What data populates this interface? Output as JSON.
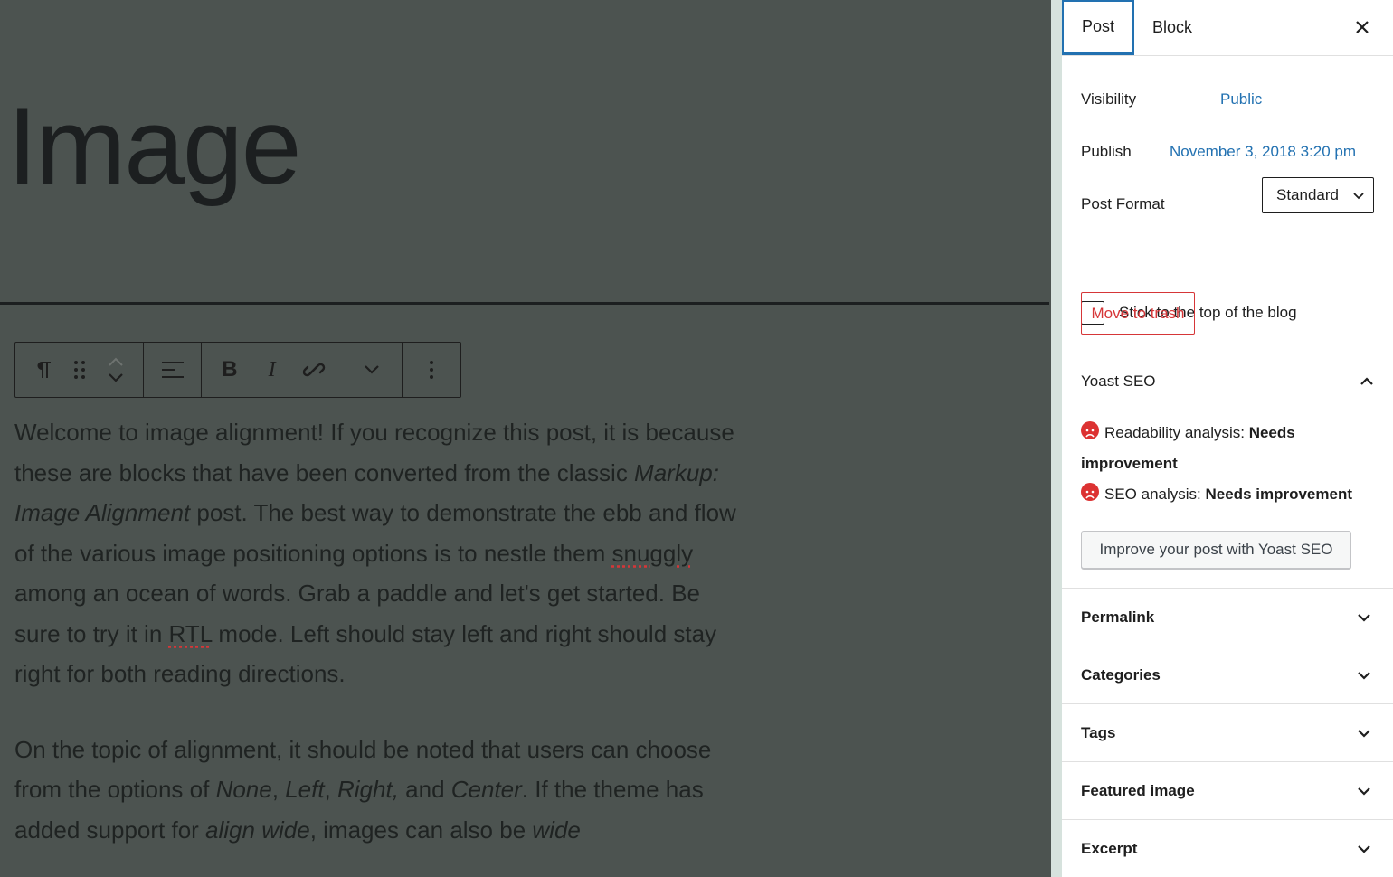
{
  "editor": {
    "title": "Image",
    "toolbar": {
      "paragraph_icon": "paragraph-icon",
      "drag_icon": "drag-handle-icon",
      "move_icons": [
        "chevron-up-icon",
        "chevron-down-icon"
      ],
      "align_icon": "align-left-icon",
      "bold_label": "B",
      "italic_label": "I",
      "link_icon": "link-icon",
      "more_icon": "chevron-down-icon",
      "options_icon": "more-vertical-icon"
    },
    "paragraph1": {
      "part1": "Welcome to image alignment! If you recognize this post, it is because these are blocks that have been converted from the classic ",
      "em1": "Markup: Image Alignment",
      "part2": " post. The best way to demonstrate the ebb and flow of the various image positioning options is to nestle them ",
      "spell1": "snuggly",
      "part3": " among an ocean of words. Grab a paddle and let's get started. Be sure to try it in ",
      "spell2": "RTL",
      "part4": " mode. Left should stay left and right should stay right for both reading directions."
    },
    "paragraph2": {
      "part1": "On the topic of alignment, it should be noted that users can choose from the options of ",
      "em1": "None",
      "sep1": ", ",
      "em2": "Left",
      "sep2": ", ",
      "em3": "Right,",
      "part2": " and ",
      "em4": "Center",
      "part3": ". If the theme has added support for ",
      "em5": "align wide",
      "part4": ", images can also be ",
      "em6": "wide"
    }
  },
  "sidebar": {
    "tabs": [
      {
        "label": "Post",
        "active": true
      },
      {
        "label": "Block",
        "active": false
      }
    ],
    "close_icon": "close-icon",
    "visibility_label": "Visibility",
    "visibility_value": "Public",
    "publish_label": "Publish",
    "publish_value": "November 3, 2018 3:20 pm",
    "post_format_label": "Post Format",
    "post_format_value": "Standard",
    "sticky_label": "Stick to the top of the blog",
    "trash_label": "Move to trash",
    "yoast": {
      "title": "Yoast SEO",
      "readability_label": "Readability analysis: ",
      "readability_value": "Needs",
      "readability_value2": "improvement",
      "seo_label": "SEO analysis: ",
      "seo_value": "Needs improvement",
      "button_label": "Improve your post with Yoast SEO",
      "status_color": "#dc3232"
    },
    "panels": [
      "Permalink",
      "Categories",
      "Tags",
      "Featured image",
      "Excerpt"
    ]
  },
  "colors": {
    "accent": "#2271b1",
    "danger": "#d63638",
    "overlay": "#4c5350"
  }
}
